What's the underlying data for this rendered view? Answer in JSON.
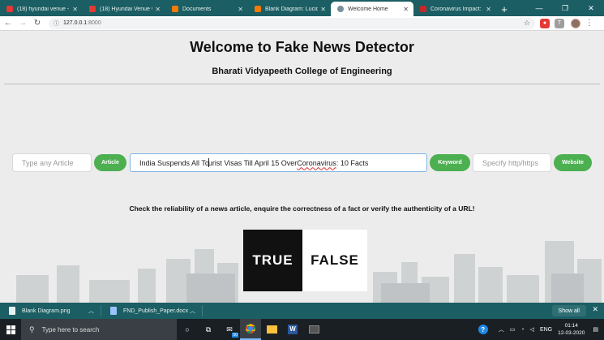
{
  "browser": {
    "tabs": [
      {
        "title": "(18) hyundai venue - Yo",
        "icon_color": "#e53935",
        "icon": "youtube-icon",
        "active": false
      },
      {
        "title": "(18) Hyundai Venue vs I",
        "icon_color": "#e53935",
        "icon": "youtube-icon",
        "active": false
      },
      {
        "title": "Documents",
        "icon_color": "#f57c00",
        "icon": "lucidchart-icon",
        "active": false
      },
      {
        "title": "Blank Diagram: Lucidch",
        "icon_color": "#f57c00",
        "icon": "lucidchart-icon",
        "active": false
      },
      {
        "title": "Welcome Home",
        "icon_color": "#78909c",
        "icon": "globe-icon",
        "active": true
      },
      {
        "title": "Coronavirus Impact: Ind",
        "icon_color": "#c62828",
        "icon": "news-icon",
        "active": false
      }
    ],
    "new_tab": "+",
    "url_host": "127.0.0.1",
    "url_port": ":8000"
  },
  "page": {
    "title": "Welcome to Fake News Detector",
    "subtitle": "Bharati Vidyapeeth College of Engineering",
    "article_placeholder": "Type any Article",
    "article_button": "Article",
    "keyword_value_before_caret": "India Suspends All To",
    "keyword_value_after_caret": "urist Visas Till April 15 Over ",
    "keyword_value_misspelled": "Coronavirus",
    "keyword_value_end": ": 10 Facts",
    "keyword_button": "Keyword",
    "website_placeholder": "Specify http/https",
    "website_button": "Website",
    "tagline": "Check the reliability of a news article, enquire the correctness of a fact or verify the authenticity of a URL!",
    "logo_true": "TRUE",
    "logo_false": "FALSE"
  },
  "downloads": {
    "items": [
      {
        "name": "Blank Diagram.png"
      },
      {
        "name": "FND_Publish_Paper.docx"
      }
    ],
    "show_all": "Show all"
  },
  "taskbar": {
    "search_placeholder": "Type here to search",
    "mail_badge": "50",
    "language": "ENG",
    "time": "01:14",
    "date": "12-03-2020"
  }
}
